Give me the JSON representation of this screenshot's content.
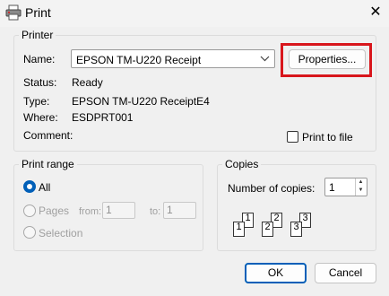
{
  "window": {
    "title": "Print",
    "close_icon": "close-icon"
  },
  "printer": {
    "group_label": "Printer",
    "name_label": "Name:",
    "name_value": "EPSON TM-U220 Receipt",
    "properties_label": "Properties...",
    "status_label": "Status:",
    "status_value": "Ready",
    "type_label": "Type:",
    "type_value": "EPSON TM-U220 ReceiptE4",
    "where_label": "Where:",
    "where_value": "ESDPRT001",
    "comment_label": "Comment:",
    "print_to_file_label": "Print to file",
    "print_to_file_checked": false
  },
  "print_range": {
    "group_label": "Print range",
    "all_label": "All",
    "pages_label": "Pages",
    "from_label": "from:",
    "from_value": "1",
    "to_label": "to:",
    "to_value": "1",
    "selection_label": "Selection",
    "selected": "All"
  },
  "copies": {
    "group_label": "Copies",
    "number_label": "Number of copies:",
    "number_value": "1",
    "collate_pages": [
      {
        "back": "1",
        "front": "1"
      },
      {
        "back": "2",
        "front": "2"
      },
      {
        "back": "3",
        "front": "3"
      }
    ]
  },
  "buttons": {
    "ok_label": "OK",
    "cancel_label": "Cancel"
  },
  "colors": {
    "accent": "#005fb8",
    "highlight": "#d8161c"
  }
}
